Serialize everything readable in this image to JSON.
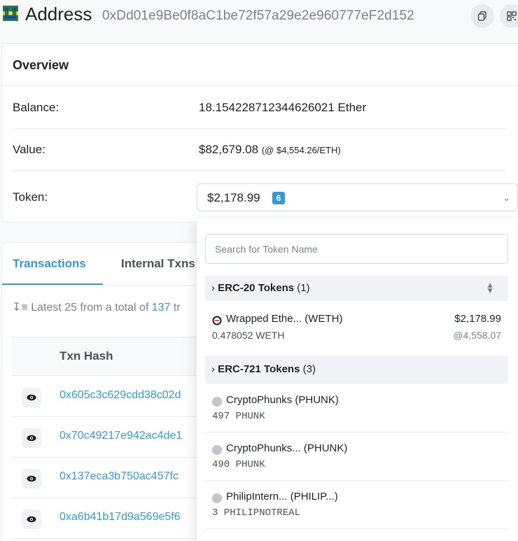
{
  "header": {
    "title": "Address",
    "address": "0xDd01e9Be0f8aC1be72f57a29e2e960777eF2d152"
  },
  "overview": {
    "heading": "Overview",
    "balance_label": "Balance:",
    "balance_value": "18.154228712344626021 Ether",
    "value_label": "Value:",
    "value_amount": "$82,679.08",
    "value_rate": "(@ $4,554.26/ETH)",
    "token_label": "Token:",
    "token_amount": "$2,178.99",
    "token_count": "6"
  },
  "tabs": {
    "active": "Transactions",
    "inactive": "Internal Txns"
  },
  "transactions": {
    "latest_prefix": "Latest 25 from a total of",
    "latest_count": "137",
    "latest_suffix": "tr",
    "column_hash": "Txn Hash",
    "rows": [
      {
        "hash": "0x605c3c629cdd38c02d"
      },
      {
        "hash": "0x70c49217e942ac4de1"
      },
      {
        "hash": "0x137eca3b750ac457fc"
      },
      {
        "hash": "0xa6b41b17d9a569e5f6"
      }
    ]
  },
  "dropdown": {
    "search_placeholder": "Search for Token Name",
    "erc20_title": "ERC-20 Tokens",
    "erc20_count": "(1)",
    "erc721_title": "ERC-721 Tokens",
    "erc721_count": "(3)",
    "erc20_tokens": [
      {
        "name": "Wrapped Ethe... (WETH)",
        "qty": "0.478052 WETH",
        "value": "$2,178.99",
        "rate": "@4,558.07"
      }
    ],
    "erc721_tokens": [
      {
        "name": "CryptoPhunks (PHUNK)",
        "qty": "497 PHUNK"
      },
      {
        "name": "CryptoPhunks... (PHUNK)",
        "qty": "490 PHUNK"
      },
      {
        "name": "PhilipIntern... (PHILIP...)",
        "qty": "3 PHILIPNOTREAL"
      }
    ]
  },
  "colors": {
    "accent": "#3498db",
    "text": "#1e2022",
    "muted": "#77838f"
  }
}
